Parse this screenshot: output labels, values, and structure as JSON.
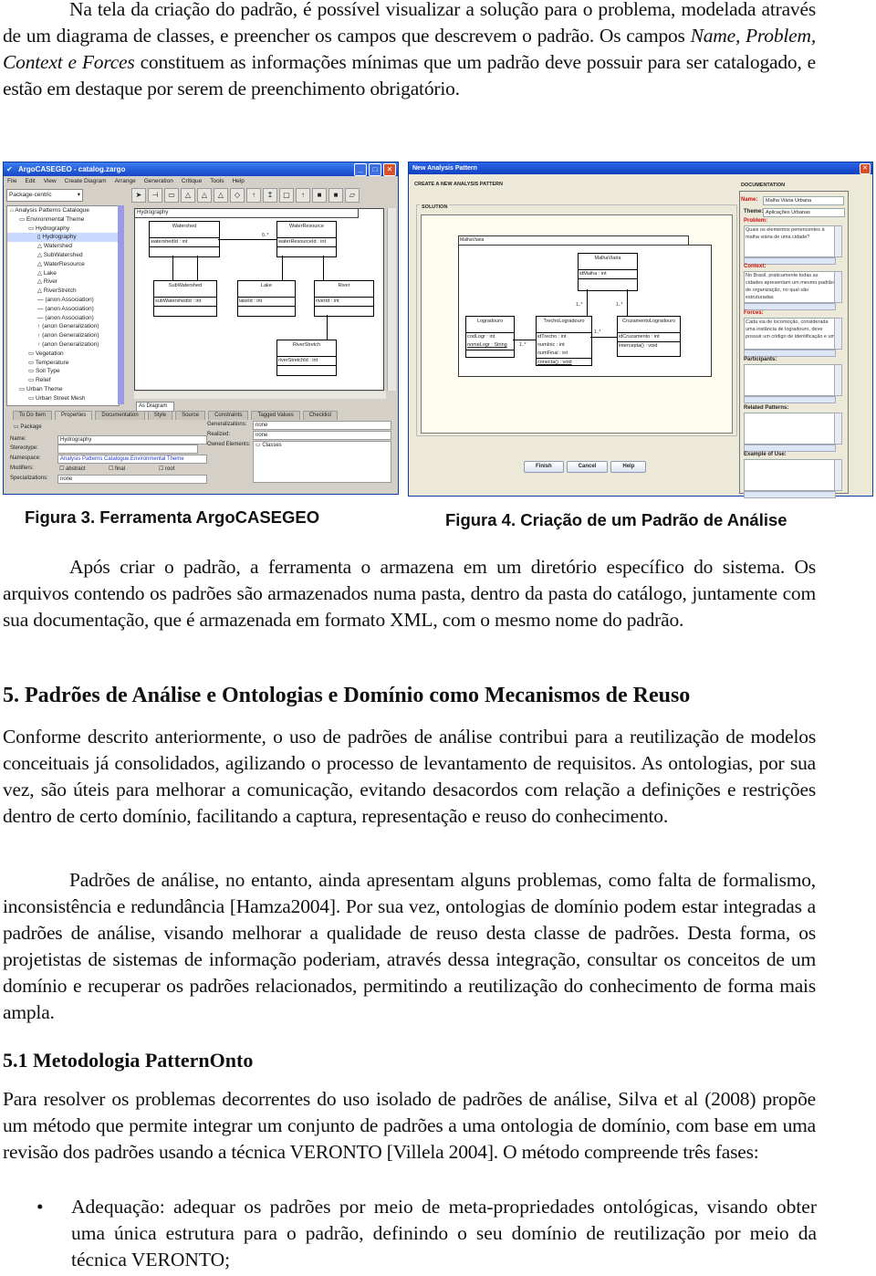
{
  "paragraphs": {
    "p1": "Na tela da criação do padrão, é possível visualizar a solução para o problema, modelada através de um diagrama de classes, e preencher os campos que descrevem o padrão. Os campos ",
    "p1_italic": "Name, Problem, Context e Forces",
    "p1_end": " constituem as informações mínimas que um padrão deve possuir para ser catalogado, e estão em destaque por serem de preenchimento obrigatório.",
    "p2": "Após criar o padrão, a ferramenta o armazena em um diretório específico do sistema. Os arquivos contendo os padrões são armazenados numa pasta, dentro da pasta do catálogo, juntamente com sua documentação, que é armazenada em formato XML, com o mesmo nome do padrão.",
    "p3": "Conforme descrito anteriormente, o uso de padrões de análise contribui para a reutilização de modelos conceituais já consolidados, agilizando o processo de levantamento de requisitos. As ontologias, por sua vez, são úteis para melhorar a comunicação, evitando desacordos com relação a definições e restrições dentro de certo domínio, facilitando a captura, representação e reuso do conhecimento.",
    "p4": "Padrões de análise, no entanto, ainda apresentam alguns problemas, como falta de formalismo, inconsistência e redundância [Hamza2004]. Por sua vez, ontologias de domínio podem estar integradas a padrões de análise, visando melhorar a qualidade de reuso desta classe de padrões. Desta forma, os projetistas de sistemas de informação poderiam, através dessa integração, consultar os conceitos de um domínio e recuperar os padrões relacionados, permitindo a reutilização do conhecimento de forma mais ampla.",
    "p5": "Para resolver os problemas decorrentes do uso isolado de padrões de análise, Silva et al (2008) propõe um método que permite integrar um conjunto de padrões a uma ontologia de domínio, com base em uma revisão dos padrões usando a técnica VERONTO [Villela 2004]. O método compreende três fases:"
  },
  "headings": {
    "section5": "5.  Padrões de Análise e Ontologias e Domínio como Mecanismos de Reuso",
    "section5_1": "5.1 Metodologia PatternOnto"
  },
  "bullets": [
    {
      "marker": "•",
      "text": "Adequação: adequar os padrões por meio de meta-propriedades ontológicas, visando obter uma única estrutura para o padrão, definindo o seu domínio de reutilização por meio da técnica VERONTO;"
    }
  ],
  "captions": {
    "fig3": "Figura 3.  Ferramenta ArgoCASEGEO",
    "fig4": "Figura 4. Criação de um Padrão de Análise"
  },
  "fig3": {
    "title": "ArgoCASEGEO - catalog.zargo",
    "menu": [
      "File",
      "Edit",
      "View",
      "Create Diagram",
      "Arrange",
      "Generation",
      "Critique",
      "Tools",
      "Help"
    ],
    "perspective": "Package-centric",
    "tree": [
      {
        "label": "Analysis Patterns Catalogue",
        "level": 0
      },
      {
        "label": "Environmental Theme",
        "level": 1
      },
      {
        "label": "Hydrography",
        "level": 2
      },
      {
        "label": "Hydrography",
        "level": 3,
        "selected": true
      },
      {
        "label": "Watershed",
        "level": 3
      },
      {
        "label": "SubWatershed",
        "level": 3
      },
      {
        "label": "WaterResource",
        "level": 3
      },
      {
        "label": "Lake",
        "level": 3
      },
      {
        "label": "River",
        "level": 3
      },
      {
        "label": "RiverStretch",
        "level": 3
      },
      {
        "label": "(anon Association)",
        "level": 3
      },
      {
        "label": "(anon Association)",
        "level": 3
      },
      {
        "label": "(anon Association)",
        "level": 3
      },
      {
        "label": "(anon Generalization)",
        "level": 3
      },
      {
        "label": "(anon Generalization)",
        "level": 3
      },
      {
        "label": "(anon Generalization)",
        "level": 3
      },
      {
        "label": "Vegetation",
        "level": 2
      },
      {
        "label": "Temperature",
        "level": 2
      },
      {
        "label": "Soil Type",
        "level": 2
      },
      {
        "label": "Relief",
        "level": 2
      },
      {
        "label": "Urban Theme",
        "level": 1
      },
      {
        "label": "Urban Street Mesh",
        "level": 2
      }
    ],
    "diagram_tab": "Hydrography",
    "diagram_bottom_tab": "As Diagram",
    "classes": {
      "watershed": {
        "name": "Watershed",
        "attr": "watershedId : int"
      },
      "waterresource": {
        "name": "WaterResource",
        "attr": "waterResourceId : int"
      },
      "subwatershed": {
        "name": "SubWatershed",
        "attr": "subWatershedId : int"
      },
      "lake": {
        "name": "Lake",
        "attr": "lakeId : int"
      },
      "river": {
        "name": "River",
        "attr": "riverId : int"
      },
      "riverstretch": {
        "name": "RiverStretch",
        "attr": "riverStretchId : int"
      }
    },
    "multiplicity": "0..*",
    "tabs": [
      "To Do Item",
      "Properties",
      "Documentation",
      "Style",
      "Source",
      "Constraints",
      "Tagged Values",
      "Checklist"
    ],
    "props": {
      "package_label": "Package",
      "name_label": "Name:",
      "name_value": "Hydrography",
      "stereotype_label": "Stereotype:",
      "namespace_label": "Namespace:",
      "namespace_value": "Analysis Patterns Catalogue.Environmental Theme",
      "modifiers_label": "Modifiers:",
      "mod_abstract": "abstract",
      "mod_final": "final",
      "mod_root": "root",
      "specializations_label": "Specializations:",
      "specializations_value": "none",
      "generalizations_label": "Generalizations:",
      "generalizations_value": "none",
      "realized_label": "Realized:",
      "realized_value": "none",
      "owned_label": "Owned Elements:",
      "owned_value": "Classes"
    }
  },
  "fig4": {
    "title": "New Analysis Pattern",
    "heading": "CREATE A NEW ANALYSIS PATTERN",
    "solution_label": "SOLUTION",
    "package_tab": "MalhaViaria",
    "classes": {
      "malha": {
        "name": "MalhaViaria",
        "attrs": [
          "idMalha : int"
        ]
      },
      "logradouro": {
        "name": "Logradouro",
        "attrs": [
          "codLogr : int",
          "nomeLogr : String"
        ]
      },
      "trecho": {
        "name": "TrechoLogradouro",
        "attrs": [
          "idTrecho : int",
          "numInic : int",
          "numFinal : int"
        ],
        "ops": [
          "conecta() : void"
        ]
      },
      "cruzamento": {
        "name": "CruzamentoLogradouro",
        "attrs": [
          "idCruzamento : int"
        ],
        "ops": [
          "intercepta() : void"
        ]
      }
    },
    "multiplicity": "1..*",
    "buttons": {
      "finish": "Finish",
      "cancel": "Cancel",
      "help": "Help"
    },
    "documentation": {
      "legend": "DOCUMENTATION",
      "name_label": "Name:",
      "name_value": "Malha Viária Urbana",
      "theme_label": "Theme:",
      "theme_value": "Aplicações Urbanas",
      "problem_label": "Problem:",
      "problem_value": "Quais os elementos pertencentes à malha viária de uma cidade?",
      "context_label": "Context:",
      "context_value": "No Brasil, praticamente todas as cidades apresentam um mesmo padrão de organização, no qual são estruturadas",
      "forces_label": "Forces:",
      "forces_value": "Cada via de locomoção, considerada uma instância de logradouro, deve possuir um código de identificação e um",
      "participants_label": "Participants:",
      "related_label": "Related Patterns:",
      "example_label": "Example of Use:"
    }
  }
}
